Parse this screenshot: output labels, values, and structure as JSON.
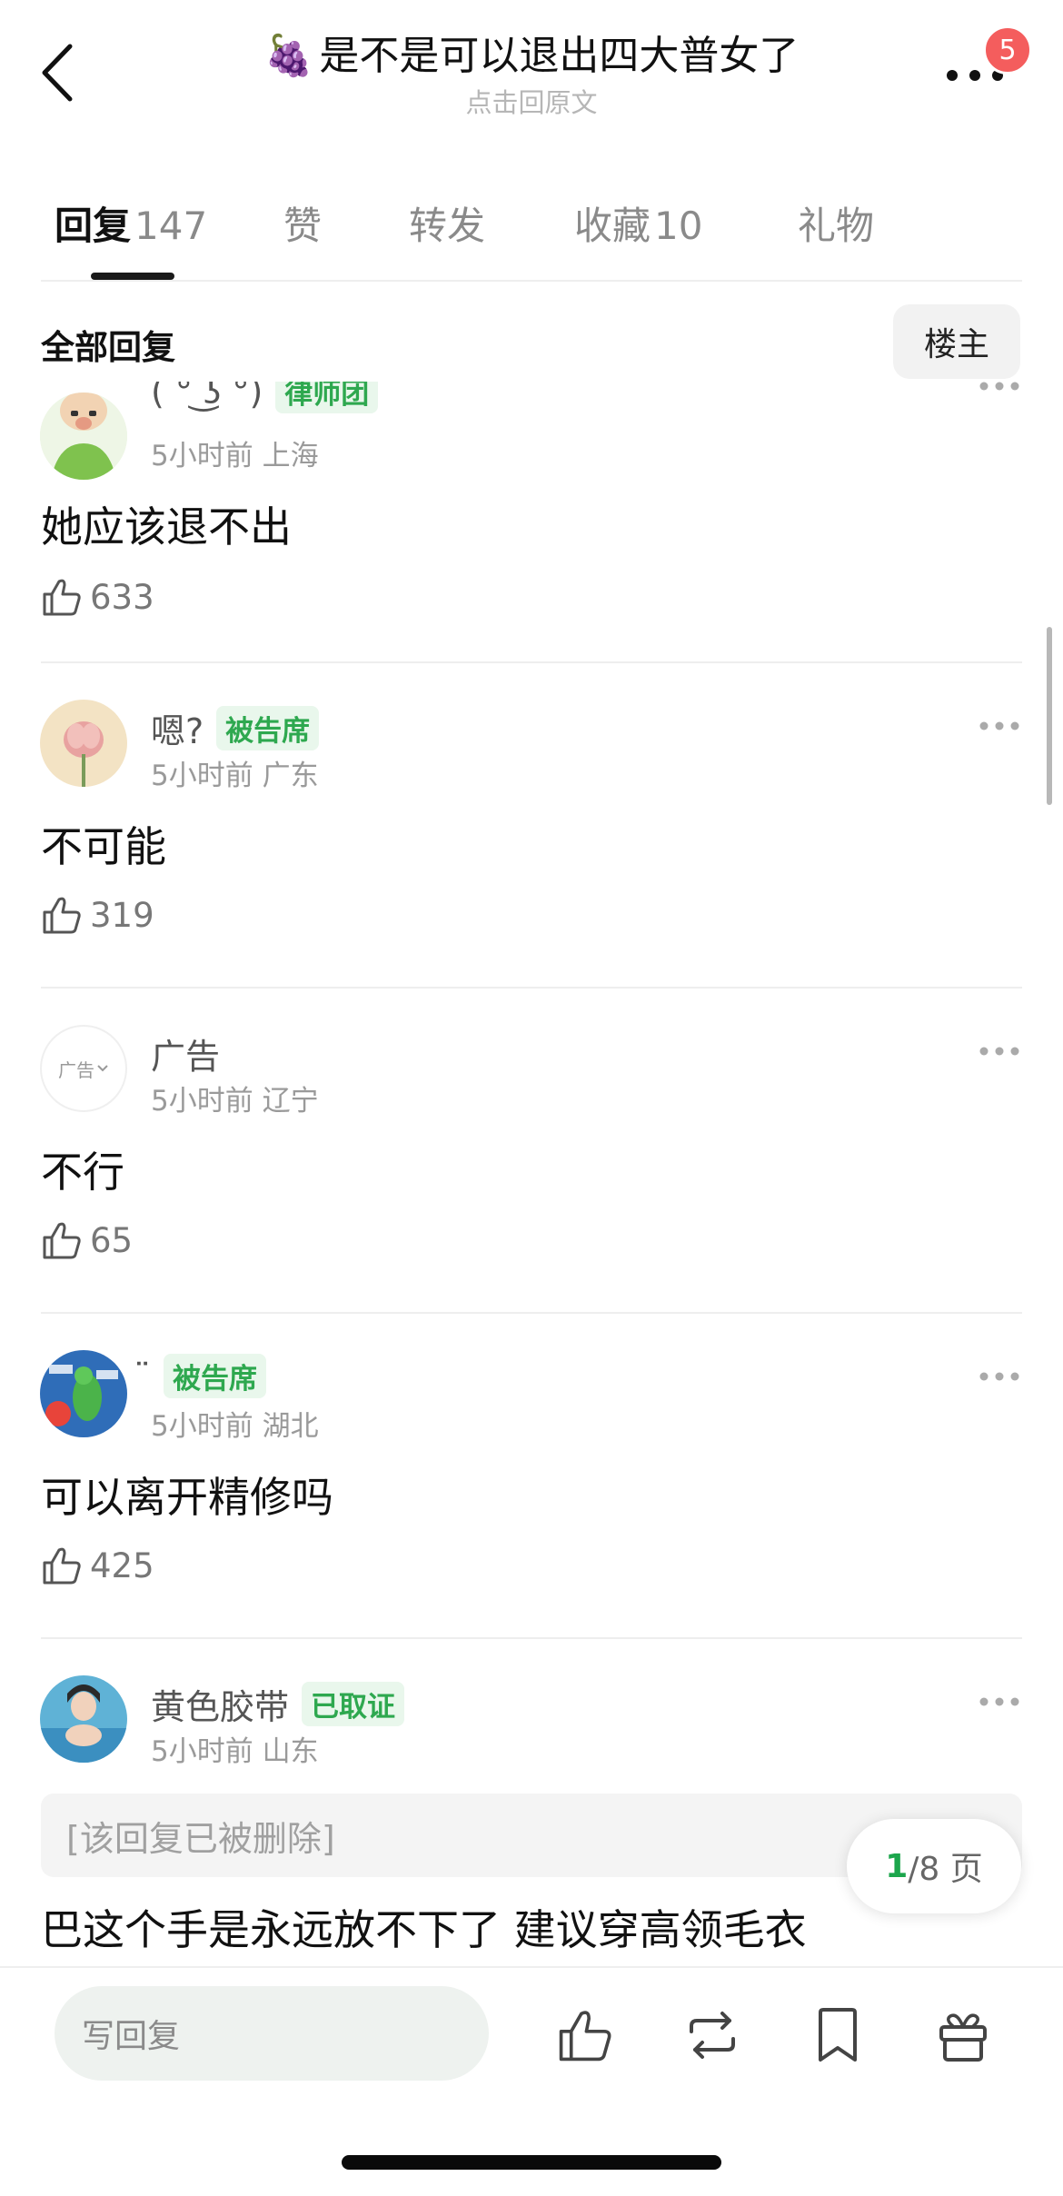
{
  "header": {
    "title_emoji": "🍇",
    "title": "是不是可以退出四大普女了",
    "subtitle": "点击回原文",
    "notification_count": "5"
  },
  "tabs": [
    {
      "label": "回复",
      "count": "147",
      "active": true
    },
    {
      "label": "赞",
      "count": "",
      "active": false
    },
    {
      "label": "转发",
      "count": "",
      "active": false
    },
    {
      "label": "收藏",
      "count": "10",
      "active": false
    },
    {
      "label": "礼物",
      "count": "",
      "active": false
    }
  ],
  "filter": {
    "title": "全部回复",
    "owner_button": "楼主"
  },
  "comments": [
    {
      "name": "( ͡° ͜ʖ ͡°)",
      "badge": "律师团",
      "time": "5小时前",
      "location": "上海",
      "text": "她应该退不出",
      "likes": "633"
    },
    {
      "name": "嗯?",
      "badge": "被告席",
      "time": "5小时前",
      "location": "广东",
      "text": "不可能",
      "likes": "319"
    },
    {
      "name": "广告",
      "badge": "",
      "avatar_label": "广告",
      "time": "5小时前",
      "location": "辽宁",
      "text": "不行",
      "likes": "65"
    },
    {
      "name": "̈",
      "badge": "被告席",
      "time": "5小时前",
      "location": "湖北",
      "text": "可以离开精修吗",
      "likes": "425"
    },
    {
      "name": "黄色胶带",
      "badge": "已取证",
      "time": "5小时前",
      "location": "山东",
      "deleted_quote": "[该回复已被删除]",
      "text": "巴这个手是永远放不下了  建议穿高领毛衣",
      "likes": ""
    }
  ],
  "pagination": {
    "current": "1",
    "total": "/8 页"
  },
  "bottom_bar": {
    "reply_placeholder": "写回复",
    "icons": [
      "like-icon",
      "repost-icon",
      "bookmark-icon",
      "gift-icon"
    ]
  },
  "colors": {
    "accent_green": "#2ea84f",
    "badge_red": "#f45d5d"
  }
}
